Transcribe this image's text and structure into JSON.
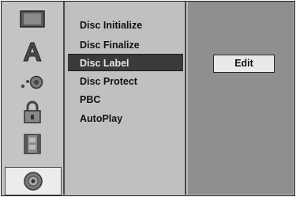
{
  "sidebar": {
    "icons": [
      {
        "name": "monitor-icon"
      },
      {
        "name": "language-icon"
      },
      {
        "name": "audio-icon"
      },
      {
        "name": "lock-icon"
      },
      {
        "name": "film-icon"
      },
      {
        "name": "disc-icon",
        "selected": true
      }
    ]
  },
  "menu": {
    "items": [
      {
        "label": "Disc Initialize"
      },
      {
        "label": "Disc Finalize"
      },
      {
        "label": "Disc Label",
        "selected": true
      },
      {
        "label": "Disc Protect"
      },
      {
        "label": "PBC"
      },
      {
        "label": "AutoPlay"
      }
    ]
  },
  "action": {
    "edit_label": "Edit"
  },
  "colors": {
    "selected_bg": "#3a3a3a",
    "panel_bg": "#c0c0c0",
    "right_bg": "#8f8f8f"
  }
}
